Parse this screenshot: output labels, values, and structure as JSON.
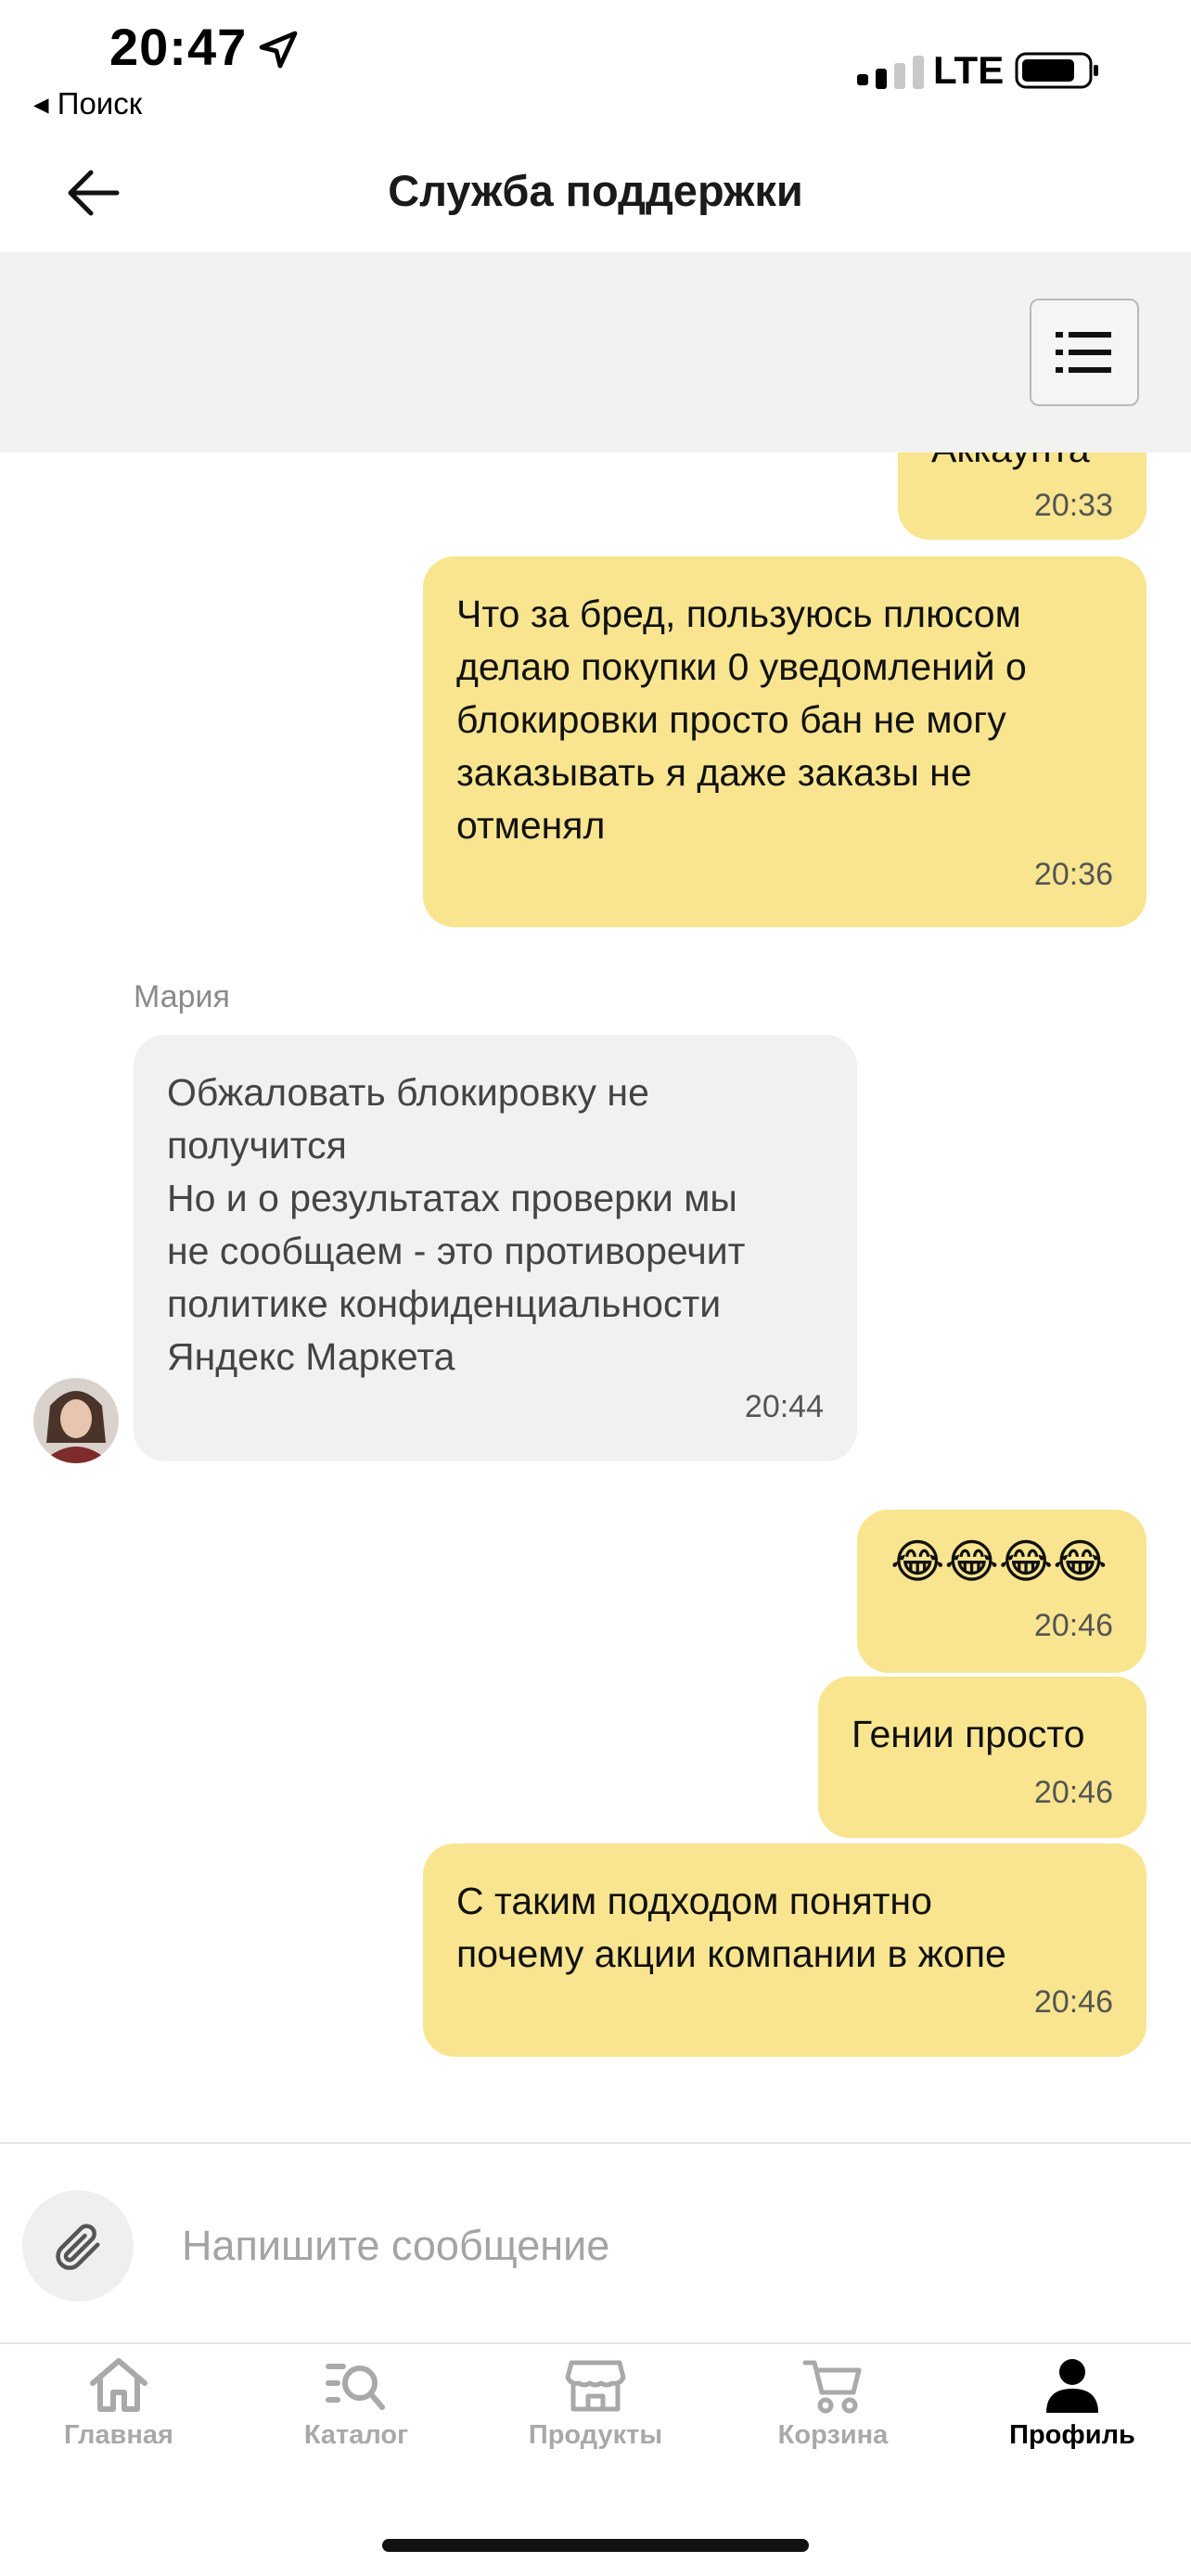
{
  "status_bar": {
    "time": "20:47",
    "back_app": "◂ Поиск",
    "network": "LTE"
  },
  "header": {
    "title": "Служба поддержки",
    "back_icon": "arrow-left-icon",
    "menu_icon": "list-icon"
  },
  "messages": [
    {
      "direction": "out",
      "text": "Аккаунта",
      "time": "20:33"
    },
    {
      "direction": "out",
      "text": "Что за бред, пользуюсь плюсом\nделаю покупки 0 уведомлений о\nблокировки просто бан не могу\nзаказывать я даже заказы не\nотменял",
      "time": "20:36"
    },
    {
      "direction": "in",
      "sender": "Мария",
      "text": "Обжаловать блокировку не\nполучится\nНо и о результатах проверки мы\nне сообщаем - это противоречит\nполитике конфиденциальности\nЯндекс Маркета",
      "time": "20:44"
    },
    {
      "direction": "out",
      "text": "😂😂😂😂",
      "time": "20:46"
    },
    {
      "direction": "out",
      "text": "Гении просто",
      "time": "20:46"
    },
    {
      "direction": "out",
      "text": "С таким подходом понятно\nпочему акции компании в жопе",
      "time": "20:46"
    }
  ],
  "composer": {
    "placeholder": "Напишите сообщение",
    "value": "",
    "attach_icon": "paperclip-icon"
  },
  "tabbar": {
    "active": "Профиль",
    "items": [
      {
        "label": "Главная",
        "icon": "home-icon"
      },
      {
        "label": "Каталог",
        "icon": "catalog-search-icon"
      },
      {
        "label": "Продукты",
        "icon": "store-icon"
      },
      {
        "label": "Корзина",
        "icon": "cart-icon"
      },
      {
        "label": "Профиль",
        "icon": "profile-icon"
      }
    ]
  },
  "colors": {
    "outgoing_bubble": "#f9e58f",
    "incoming_bubble": "#f1f1f0",
    "toolbar_bg": "#f2f2f1"
  }
}
